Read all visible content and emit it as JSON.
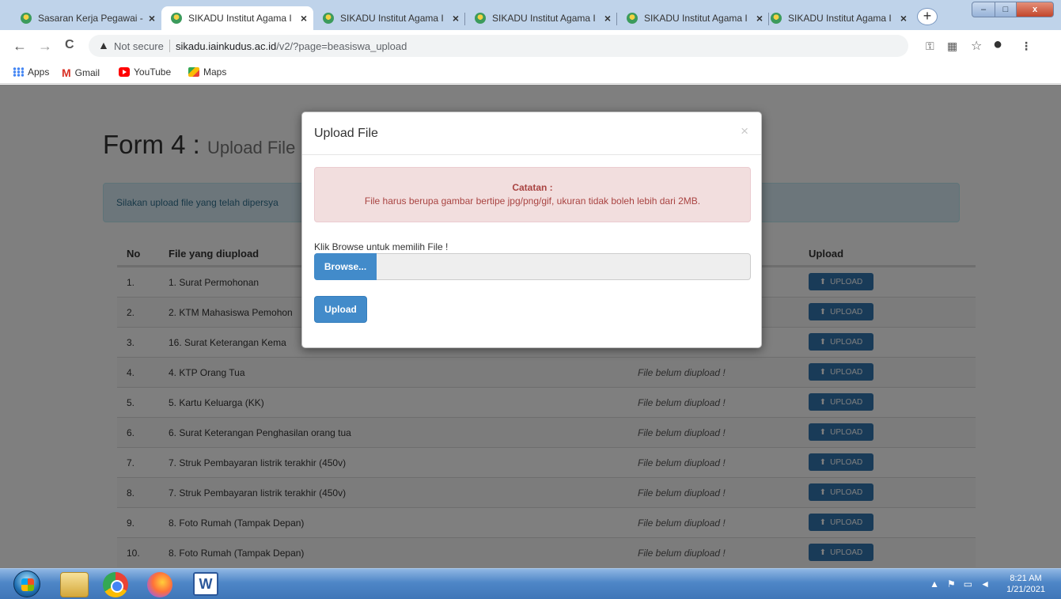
{
  "browser": {
    "tabs": [
      {
        "title": "Sasaran Kerja Pegawai -",
        "active": false
      },
      {
        "title": "SIKADU Institut Agama I",
        "active": true
      },
      {
        "title": "SIKADU Institut Agama I",
        "active": false
      },
      {
        "title": "SIKADU Institut Agama I",
        "active": false
      },
      {
        "title": "SIKADU Institut Agama I",
        "active": false
      },
      {
        "title": "SIKADU Institut Agama I",
        "active": false
      }
    ],
    "new_tab": "+",
    "tab_close": "×",
    "nav": {
      "back": "←",
      "forward": "→",
      "reload": "C"
    },
    "security_label": "Not secure",
    "url_host": "sikadu.iainkudus.ac.id",
    "url_path": "/v2/?page=beasiswa_upload",
    "bookmarks": [
      "Apps",
      "Gmail",
      "YouTube",
      "Maps"
    ],
    "window_controls": {
      "minimize": "–",
      "maximize": "□",
      "close": "x"
    }
  },
  "page": {
    "form_title": "Form 4 :",
    "form_subtitle": "Upload File",
    "info_text": "Silakan upload file yang telah dipersya",
    "table": {
      "headers": {
        "no": "No",
        "file": "File yang diupload",
        "upload": "Upload"
      },
      "rows": [
        {
          "no": "1.",
          "name": "1. Surat Permohonan",
          "status": ""
        },
        {
          "no": "2.",
          "name": "2. KTM Mahasiswa Pemohon",
          "status": ""
        },
        {
          "no": "3.",
          "name": "16. Surat Keterangan Kema",
          "status": ""
        },
        {
          "no": "4.",
          "name": "4. KTP Orang Tua",
          "status": "File belum diupload !"
        },
        {
          "no": "5.",
          "name": "5. Kartu Keluarga (KK)",
          "status": "File belum diupload !"
        },
        {
          "no": "6.",
          "name": "6. Surat Keterangan Penghasilan orang tua",
          "status": "File belum diupload !"
        },
        {
          "no": "7.",
          "name": "7. Struk Pembayaran listrik terakhir (450v)",
          "status": "File belum diupload !"
        },
        {
          "no": "8.",
          "name": "7. Struk Pembayaran listrik terakhir (450v)",
          "status": "File belum diupload !"
        },
        {
          "no": "9.",
          "name": "8. Foto Rumah (Tampak Depan)",
          "status": "File belum diupload !"
        },
        {
          "no": "10.",
          "name": "8. Foto Rumah (Tampak Depan)",
          "status": "File belum diupload !"
        }
      ],
      "upload_button_label": "UPLOAD"
    }
  },
  "modal": {
    "title": "Upload File",
    "close": "×",
    "alert_title": "Catatan :",
    "alert_message": "File harus berupa gambar bertipe jpg/png/gif, ukuran tidak boleh lebih dari 2MB.",
    "browse_label": "Klik Browse untuk memilih File !",
    "browse_button": "Browse...",
    "submit_button": "Upload"
  },
  "taskbar": {
    "time": "8:21 AM",
    "date": "1/21/2021",
    "word_letter": "W"
  },
  "colors": {
    "primary_button": "#428bca",
    "upload_button": "#3276b1",
    "alert_bg": "#f2dede",
    "alert_text": "#a94442",
    "info_bg": "#d9edf7"
  }
}
